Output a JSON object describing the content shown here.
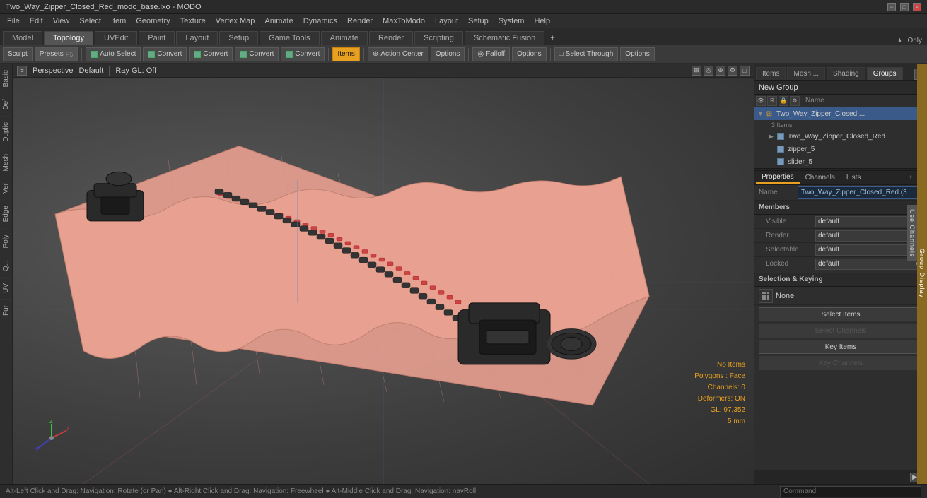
{
  "titlebar": {
    "title": "Two_Way_Zipper_Closed_Red_modo_base.lxo - MODO",
    "controls": [
      "−",
      "□",
      "×"
    ]
  },
  "menubar": {
    "items": [
      "File",
      "Edit",
      "View",
      "Select",
      "Item",
      "Geometry",
      "Texture",
      "Vertex Map",
      "Animate",
      "Dynamics",
      "Render",
      "MaxToModo",
      "Layout",
      "Setup",
      "System",
      "Help"
    ]
  },
  "main_tabs": {
    "tabs": [
      "Model",
      "Topology",
      "UVEdit",
      "Paint",
      "Layout",
      "Setup",
      "Game Tools",
      "Animate",
      "Render",
      "Scripting",
      "Schematic Fusion"
    ],
    "active": "Model",
    "add_label": "+"
  },
  "toolbar": {
    "sculpt_label": "Sculpt",
    "presets_label": "Presets",
    "preset_shortcut": "F5",
    "auto_select_label": "Auto Select",
    "convert_labels": [
      "Convert",
      "Convert",
      "Convert",
      "Convert"
    ],
    "items_label": "Items",
    "action_center_label": "Action Center",
    "options_label": "Options",
    "falloff_label": "Falloff",
    "options2_label": "Options",
    "select_through_label": "Select Through",
    "options3_label": "Options"
  },
  "viewport": {
    "perspective_label": "Perspective",
    "default_label": "Default",
    "ray_gl_label": "Ray GL: Off",
    "icons": [
      "⊞",
      "◎",
      "⊕",
      "⚙",
      "□"
    ]
  },
  "scene_overlay": {
    "no_items_label": "No Items",
    "polygons_label": "Polygons : Face",
    "channels_label": "Channels: 0",
    "deformers_label": "Deformers: ON",
    "gl_label": "GL: 97,352",
    "size_label": "5 mm"
  },
  "right_panel": {
    "top_tabs": [
      "Items",
      "Mesh ...",
      "Shading",
      "Groups"
    ],
    "active_tab": "Groups",
    "new_group_label": "New Group",
    "icon_row_buttons": [
      "⊞",
      "✎",
      "×",
      "⋮"
    ],
    "tree_columns": [
      "Name"
    ],
    "group_item": {
      "name": "Two_Way_Zipper_Closed ...",
      "count": "3 Items",
      "children": [
        {
          "name": "Two_Way_Zipper_Closed_Red",
          "type": "mesh"
        },
        {
          "name": "zipper_5",
          "type": "mesh"
        },
        {
          "name": "slider_5",
          "type": "mesh"
        }
      ]
    }
  },
  "properties": {
    "tabs": [
      "Properties",
      "Channels",
      "Lists"
    ],
    "active_tab": "Properties",
    "tab_icons": [
      "+",
      "□"
    ],
    "name_label": "Name",
    "name_value": "Two_Way_Zipper_Closed_Red (3",
    "members_label": "Members",
    "fields": [
      {
        "label": "Visible",
        "value": "default"
      },
      {
        "label": "Render",
        "value": "default"
      },
      {
        "label": "Selectable",
        "value": "default"
      },
      {
        "label": "Locked",
        "value": "default"
      }
    ],
    "selection_keying_label": "Selection & Keying",
    "keying_none_label": "None",
    "select_items_btn": "Select Items",
    "select_channels_btn": "Select Channels",
    "key_items_btn": "Key Items",
    "key_channels_btn": "Key Channels",
    "group_display_label": "Group Display",
    "use_channels_label": "Use Channels"
  },
  "statusbar": {
    "text": "Alt-Left Click and Drag: Navigation: Rotate (or Pan)   ●   Alt-Right Click and Drag: Navigation: Freewheel   ●   Alt-Middle Click and Drag: Navigation: navRoll",
    "command_placeholder": "Command"
  }
}
